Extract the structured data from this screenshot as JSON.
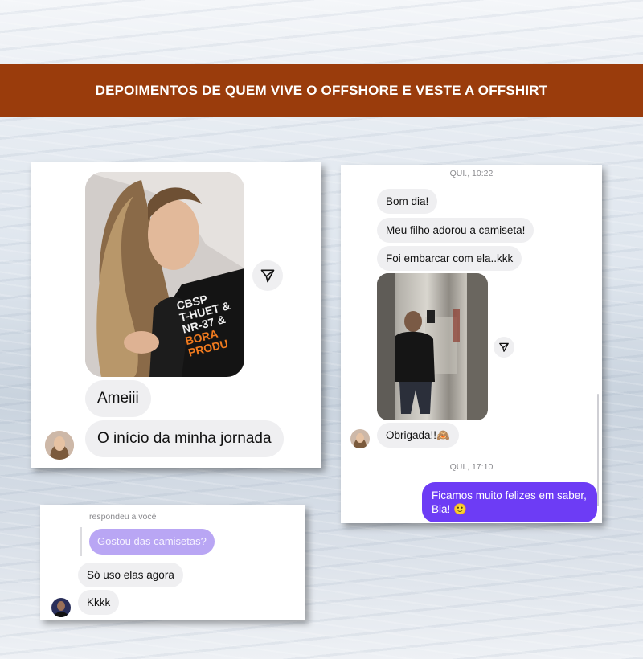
{
  "banner": {
    "title": "DEPOIMENTOS DE QUEM VIVE O OFFSHORE E VESTE A OFFSHIRT"
  },
  "chat1": {
    "shirt_text": [
      "CBSP",
      "T-HUET &",
      "NR-37 &",
      "BORA PRODU"
    ],
    "messages": [
      "Ameiii",
      "O início da minha jornada"
    ]
  },
  "chat2": {
    "timestamp1": "QUI., 10:22",
    "messages": [
      "Bom dia!",
      "Meu filho adorou a camiseta!",
      "Foi embarcar com ela..kkk",
      "Obrigada!!🙈"
    ],
    "timestamp2": "QUI., 17:10",
    "reply": "Ficamos muito felizes em saber, Bia! 🙂"
  },
  "chat3": {
    "reply_label": "respondeu a você",
    "quoted": "Gostou das camisetas?",
    "messages": [
      "Só uso elas agora",
      "Kkkk"
    ]
  },
  "colors": {
    "banner": "#9a3c0c",
    "outgoing_bubble": "#6d3cf5",
    "incoming_bubble": "#efeff1"
  }
}
